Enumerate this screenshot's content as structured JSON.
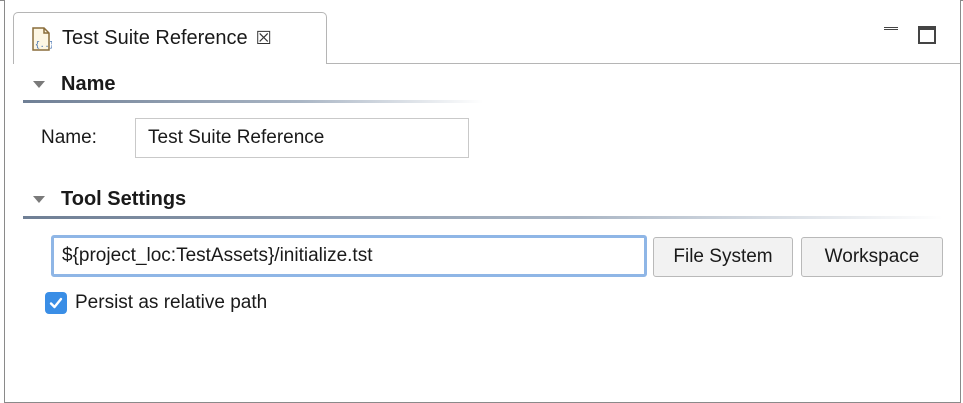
{
  "tab": {
    "title": "Test Suite Reference",
    "icon": "test-suite-reference-icon",
    "close_glyph": "☒"
  },
  "window_controls": {
    "minimize": "minimize-icon",
    "maximize": "maximize-icon"
  },
  "sections": {
    "name": {
      "title": "Name",
      "field_label": "Name:",
      "field_value": "Test Suite Reference"
    },
    "tool_settings": {
      "title": "Tool Settings",
      "path_value": "${project_loc:TestAssets}/initialize.tst",
      "file_system_label": "File System",
      "workspace_label": "Workspace",
      "persist_label": "Persist as relative path",
      "persist_checked": true
    }
  },
  "colors": {
    "accent": "#3a8ee6",
    "focus_border": "#8fb6e6",
    "section_rule": "#6f7f95"
  }
}
